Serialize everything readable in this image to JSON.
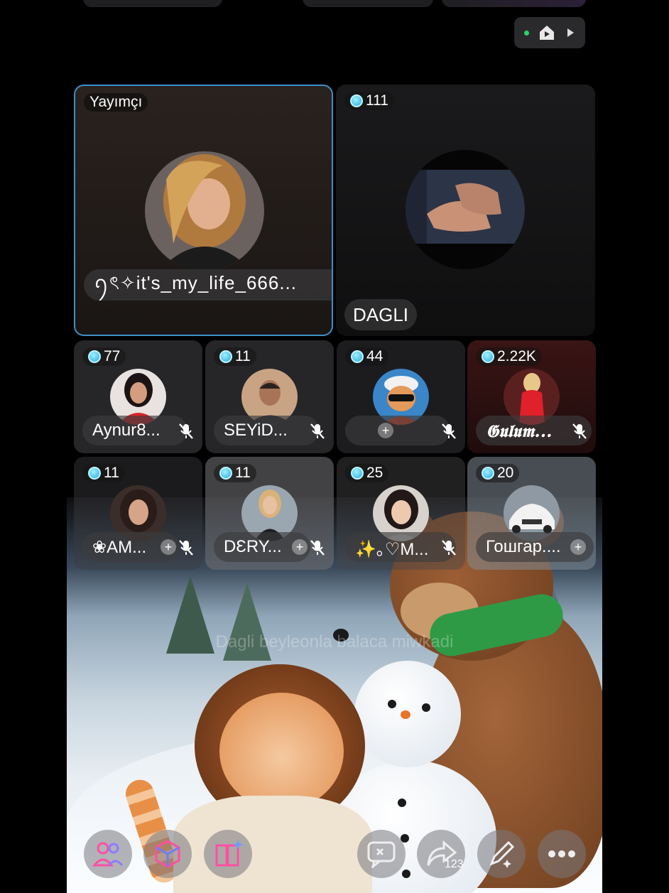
{
  "live": {
    "label": "live"
  },
  "host": {
    "role_label": "Yayımçı",
    "name": "ꪆৎ✧it's_my_life_666..."
  },
  "guest": {
    "count": "111",
    "name": "DAGLI"
  },
  "seats_row1": [
    {
      "count": "77",
      "name": "Aynur8...",
      "muted": true
    },
    {
      "count": "11",
      "name": "SEYiD...",
      "muted": true
    },
    {
      "count": "44",
      "name": "",
      "muted": true,
      "add": true
    },
    {
      "count": "2.22K",
      "name": "𝕲𝖚𝖑𝖚𝖒...",
      "muted": true
    }
  ],
  "seats_row2": [
    {
      "count": "11",
      "name": "❀AM...",
      "muted": true,
      "add": true
    },
    {
      "count": "11",
      "name": "DƐRY...",
      "muted": true,
      "add": true
    },
    {
      "count": "25",
      "name": "✨｡♡M...",
      "muted": true
    },
    {
      "count": "20",
      "name": "Гошгар....",
      "muted": false,
      "add": true
    }
  ],
  "scene_caption": "Dagli beyleonla balaca miwkadi",
  "bottom_bar": {
    "share_count": "123",
    "buttons": [
      "people-icon",
      "cube-icon",
      "book-sparkle-icon",
      "chat-icon",
      "share-icon",
      "pen-icon",
      "more-icon"
    ]
  },
  "colors": {
    "accent": "#3f8ec7",
    "pink": "#ff4fa3",
    "online": "#2bd46a"
  }
}
